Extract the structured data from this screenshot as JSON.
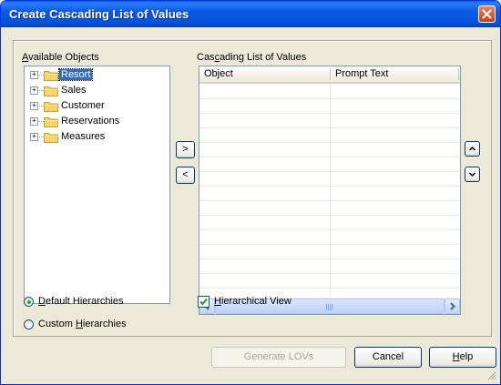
{
  "window": {
    "title": "Create Cascading List of Values"
  },
  "available_objects": {
    "label": "Available Objects",
    "label_mnemonic": "A",
    "label_rest": "vailable Objects",
    "items": [
      {
        "label": "Resort",
        "selected": true
      },
      {
        "label": "Sales",
        "selected": false
      },
      {
        "label": "Customer",
        "selected": false
      },
      {
        "label": "Reservations",
        "selected": false
      },
      {
        "label": "Measures",
        "selected": false
      }
    ]
  },
  "transfer_buttons": {
    "add": ">",
    "remove": "<"
  },
  "cascading_list": {
    "label_pre": "Cas",
    "label_mnemonic": "c",
    "label_post": "ading List of Values",
    "columns": [
      "Object",
      "Prompt Text"
    ],
    "rows": []
  },
  "order_buttons": {
    "up_icon": "arrow-up-icon",
    "down_icon": "arrow-down-icon"
  },
  "hierarchy_options": {
    "default_mnemonic": "D",
    "default_rest": "efault Hierarchies",
    "custom_pre": "Custom ",
    "custom_mnemonic": "H",
    "custom_rest": "ierarchies",
    "selected": "default"
  },
  "hierarchical_view": {
    "mnemonic": "H",
    "rest": "ierarchical View",
    "checked": true
  },
  "footer": {
    "generate_label": "Generate LOVs",
    "cancel_label": "Cancel",
    "help_mnemonic": "H",
    "help_rest": "elp"
  },
  "colors": {
    "titlebar": "#0453d6",
    "selection": "#316ac5",
    "dialog_bg": "#ece9d8"
  }
}
